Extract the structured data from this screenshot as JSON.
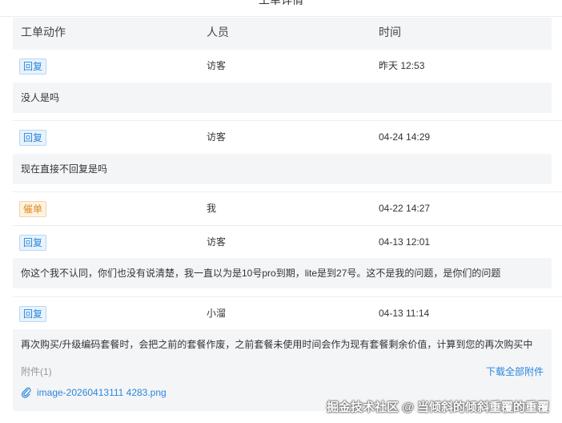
{
  "page_title": "工单详情",
  "headers": {
    "action": "工单动作",
    "person": "人员",
    "time": "时间"
  },
  "entries": [
    {
      "tag": "回复",
      "person": "访客",
      "time": "昨天 12:53",
      "message": "没人是吗"
    },
    {
      "tag": "回复",
      "person": "访客",
      "time": "04-24 14:29",
      "message": "现在直接不回复是吗"
    },
    {
      "tag": "催单",
      "person": "我",
      "time": "04-22 14:27"
    },
    {
      "tag": "回复",
      "person": "访客",
      "time": "04-13 12:01",
      "message": "你这个我不认同，你们也没有说清楚，我一直以为是10号pro到期，lite是到27号。这不是我的问题，是你们的问题"
    },
    {
      "tag": "回复",
      "person": "小溜",
      "time": "04-13 11:14",
      "message": "再次购买/升级编码套餐时，会把之前的套餐作废，之前套餐未使用时间会作为现有套餐剩余价值，计算到您的再次购买中"
    }
  ],
  "attachments": {
    "label": "附件(1)",
    "download_all": "下载全部附件",
    "file_name": "image-20260413111 4283.png"
  },
  "watermark": "掘金技术社区 @ 当倾斜的倾斜重覆的重覆"
}
